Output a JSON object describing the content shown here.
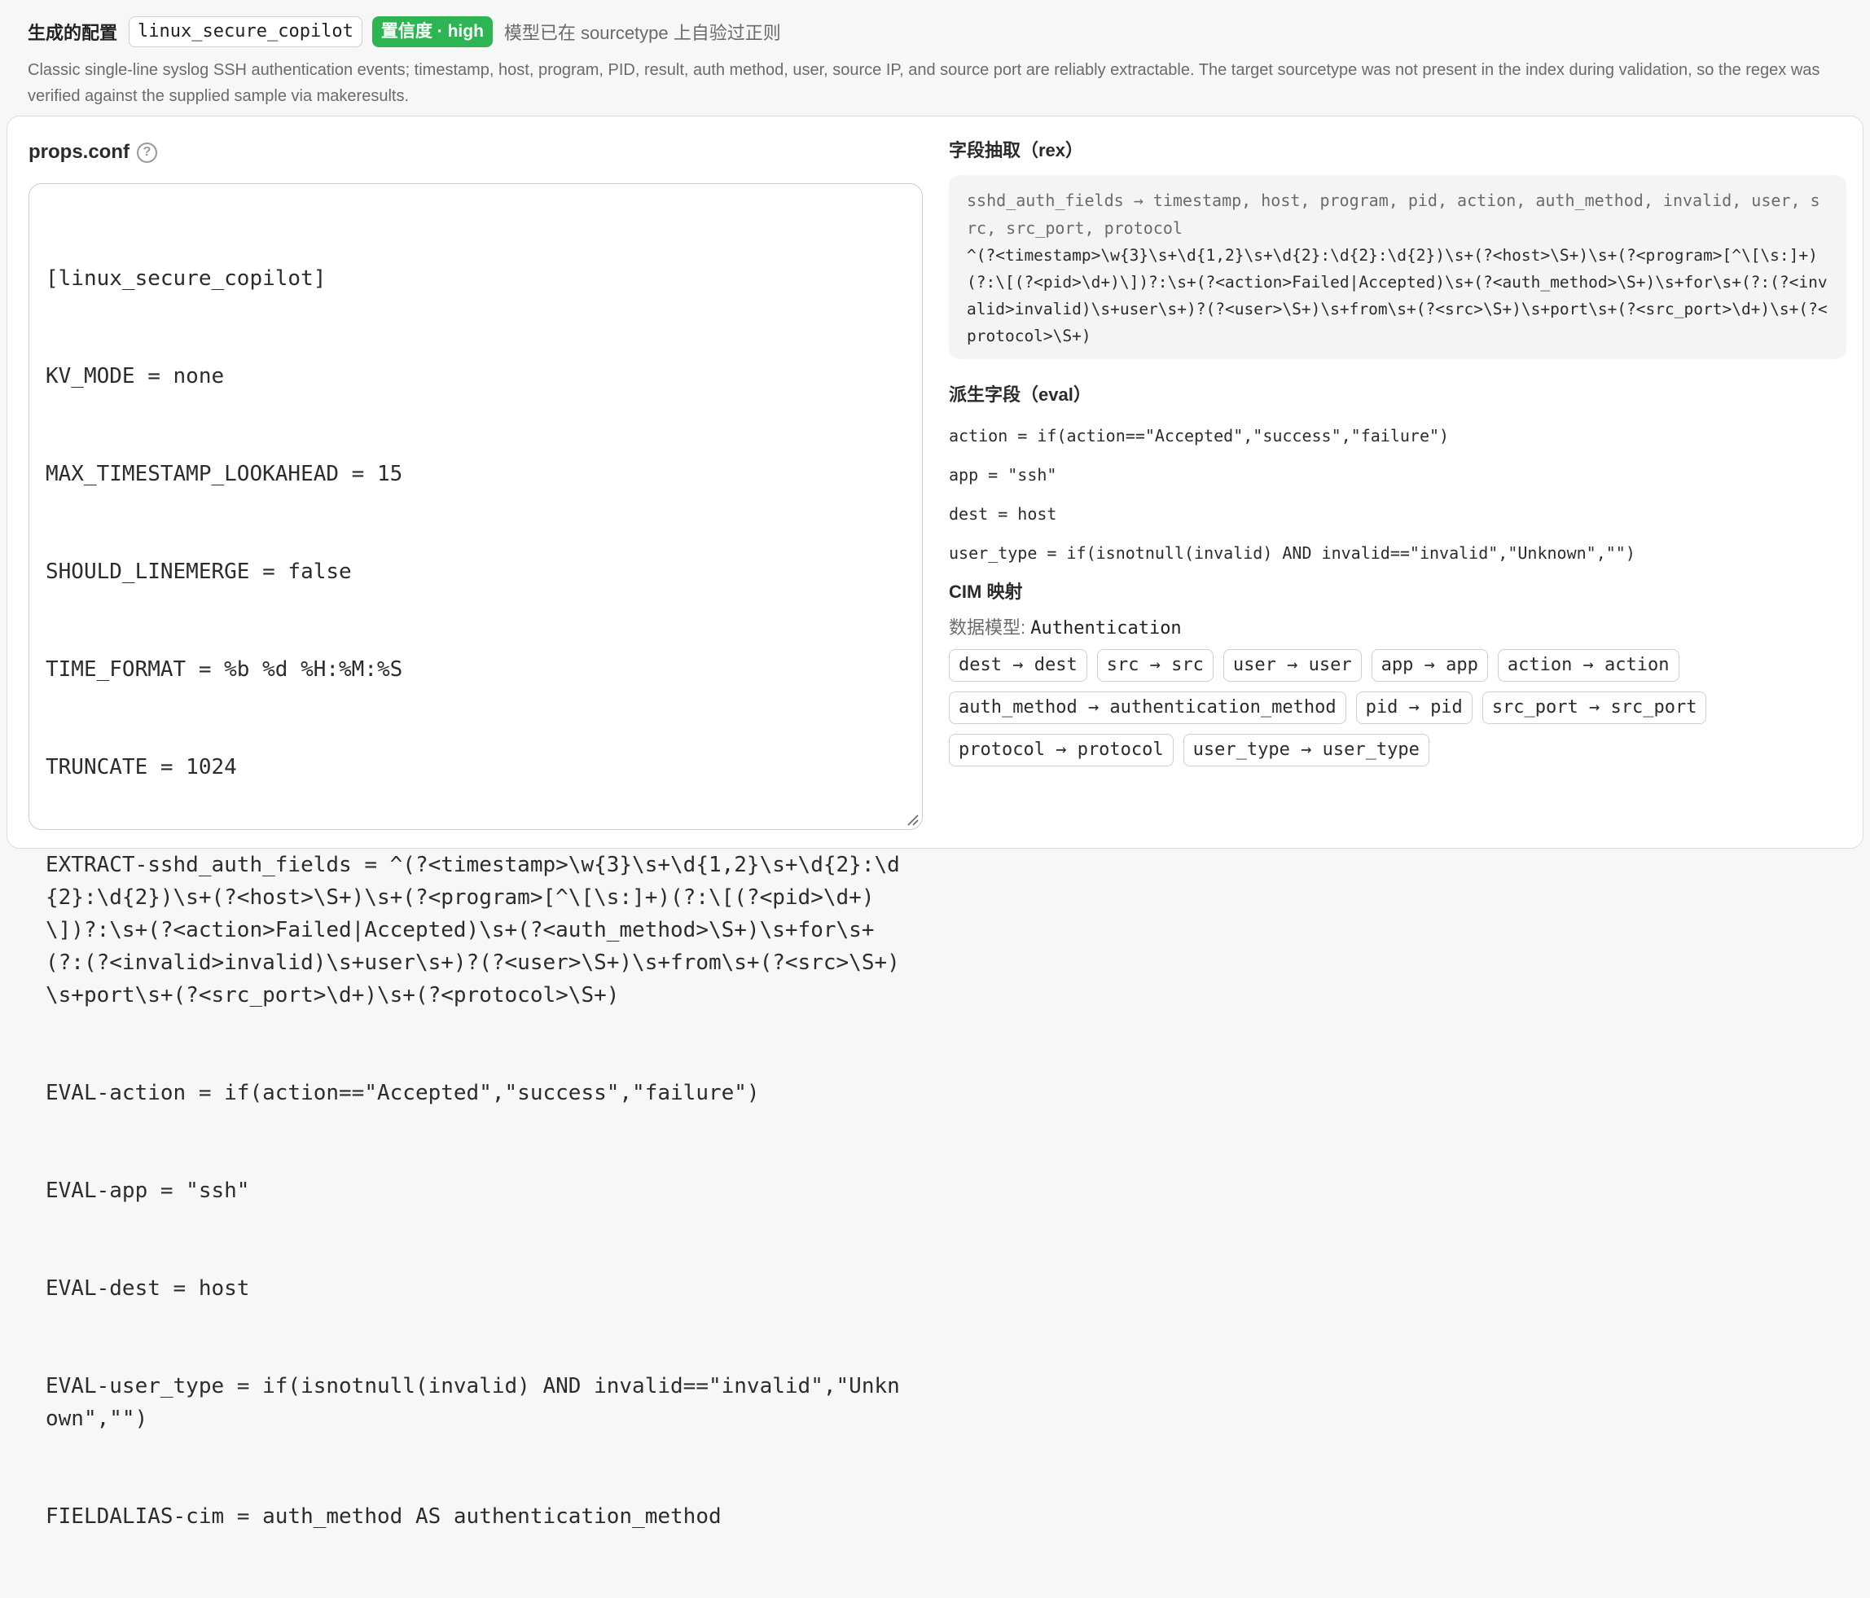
{
  "header": {
    "title": "生成的配置",
    "sourcetype": "linux_secure_copilot",
    "confidence_badge": "置信度 · high",
    "verify_note": "模型已在 sourcetype 上自验过正则",
    "description": "Classic single-line syslog SSH authentication events; timestamp, host, program, PID, result, auth method, user, source IP, and source port are reliably extractable. The target sourcetype was not present in the index during validation, so the regex was verified against the supplied sample via makeresults."
  },
  "props": {
    "title": "props.conf",
    "help_icon": "?",
    "lines": [
      "[linux_secure_copilot]",
      "KV_MODE = none",
      "MAX_TIMESTAMP_LOOKAHEAD = 15",
      "SHOULD_LINEMERGE = false",
      "TIME_FORMAT = %b %d %H:%M:%S",
      "TRUNCATE = 1024",
      "EXTRACT-sshd_auth_fields = ^(?<timestamp>\\w{3}\\s+\\d{1,2}\\s+\\d{2}:\\d{2}:\\d{2})\\s+(?<host>\\S+)\\s+(?<program>[^\\[\\s:]+)(?:\\[(?<pid>\\d+)\\])?:\\s+(?<action>Failed|Accepted)\\s+(?<auth_method>\\S+)\\s+for\\s+(?:(?<invalid>invalid)\\s+user\\s+)?(?<user>\\S+)\\s+from\\s+(?<src>\\S+)\\s+port\\s+(?<src_port>\\d+)\\s+(?<protocol>\\S+)",
      "EVAL-action = if(action==\"Accepted\",\"success\",\"failure\")",
      "EVAL-app = \"ssh\"",
      "EVAL-dest = host",
      "EVAL-user_type = if(isnotnull(invalid) AND invalid==\"invalid\",\"Unknown\",\"\")",
      "FIELDALIAS-cim = auth_method AS authentication_method"
    ]
  },
  "rex": {
    "title": "字段抽取（rex）",
    "fields": "sshd_auth_fields → timestamp, host, program, pid, action, auth_method, invalid, user, src, src_port, protocol",
    "pattern": "^(?<timestamp>\\w{3}\\s+\\d{1,2}\\s+\\d{2}:\\d{2}:\\d{2})\\s+(?<host>\\S+)\\s+(?<program>[^\\[\\s:]+)(?:\\[(?<pid>\\d+)\\])?:\\s+(?<action>Failed|Accepted)\\s+(?<auth_method>\\S+)\\s+for\\s+(?:(?<invalid>invalid)\\s+user\\s+)?(?<user>\\S+)\\s+from\\s+(?<src>\\S+)\\s+port\\s+(?<src_port>\\d+)\\s+(?<protocol>\\S+)"
  },
  "eval": {
    "title": "派生字段（eval）",
    "lines": [
      "action = if(action==\"Accepted\",\"success\",\"failure\")",
      "app = \"ssh\"",
      "dest = host",
      "user_type = if(isnotnull(invalid) AND invalid==\"invalid\",\"Unknown\",\"\")"
    ]
  },
  "cim": {
    "title": "CIM 映射",
    "model_label": "数据模型:",
    "model_value": "Authentication",
    "mappings": [
      "dest → dest",
      "src → src",
      "user → user",
      "app → app",
      "action → action",
      "auth_method → authentication_method",
      "pid → pid",
      "src_port → src_port",
      "protocol → protocol",
      "user_type → user_type"
    ]
  },
  "colors": {
    "badge_green": "#2db553",
    "muted_text": "#6b6b6b",
    "rex_background": "#f4f4f4"
  }
}
